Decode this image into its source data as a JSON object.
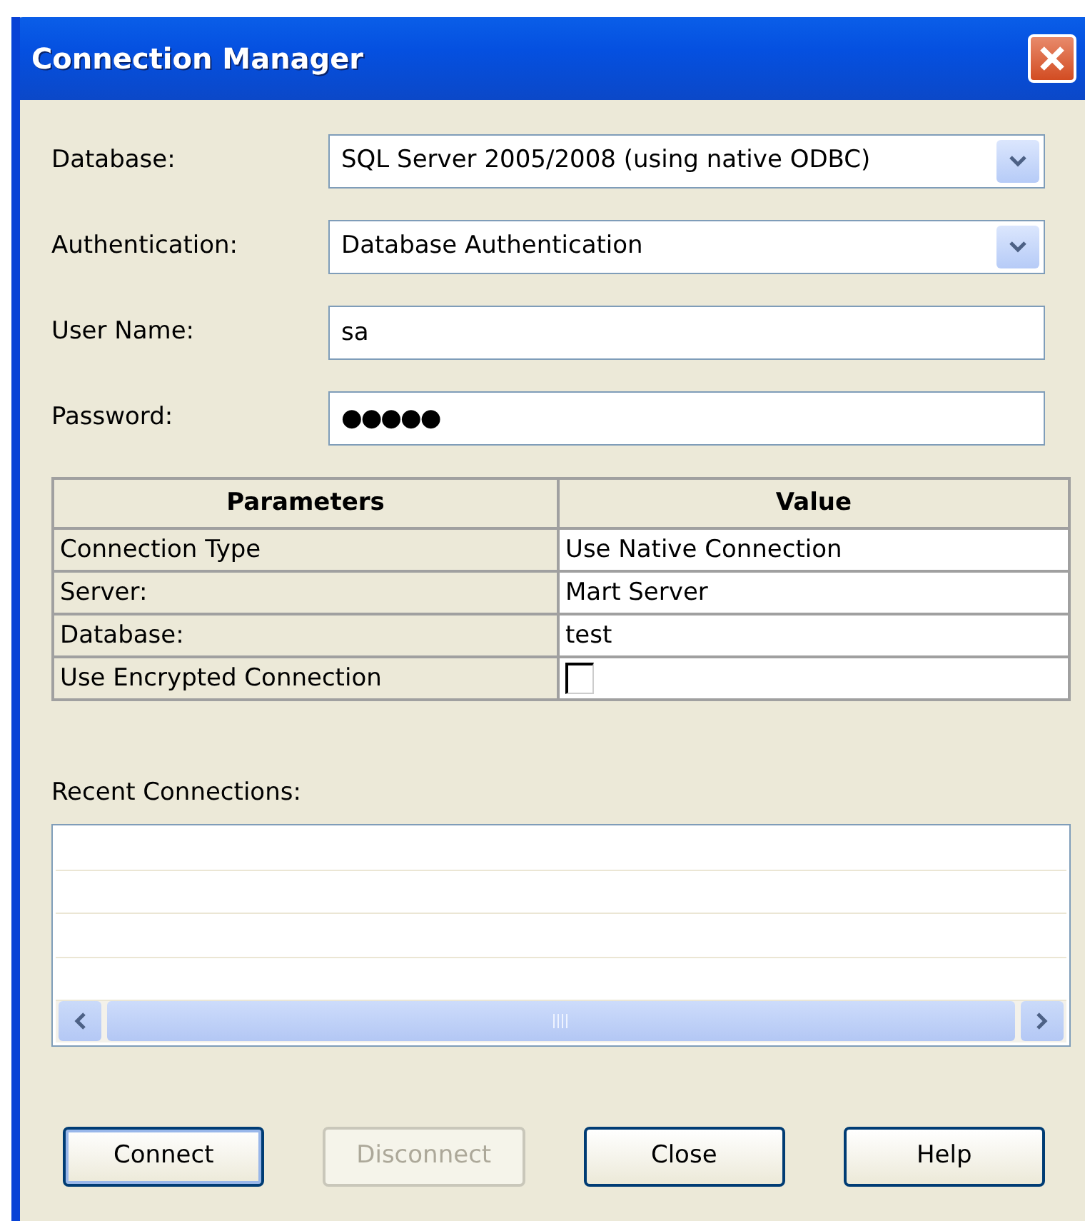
{
  "window": {
    "title": "Connection Manager"
  },
  "fields": [
    {
      "label": "Database:",
      "kind": "dropdown",
      "value": "SQL Server 2005/2008 (using native ODBC)"
    },
    {
      "label": "Authentication:",
      "kind": "dropdown",
      "value": "Database Authentication"
    },
    {
      "label": "User Name:",
      "kind": "text",
      "value": "sa"
    },
    {
      "label": "Password:",
      "kind": "password",
      "value": "●●●●●"
    }
  ],
  "parameters": {
    "columns": [
      "Parameters",
      "Value"
    ],
    "rows": [
      {
        "name": "Connection Type",
        "kind": "text",
        "value": "Use Native Connection"
      },
      {
        "name": "Server:",
        "kind": "text",
        "value": "Mart Server"
      },
      {
        "name": "Database:",
        "kind": "text",
        "value": "test"
      },
      {
        "name": "Use Encrypted Connection",
        "kind": "checkbox",
        "checked": false
      }
    ]
  },
  "recent": {
    "label": "Recent Connections:"
  },
  "buttons": [
    {
      "label": "Connect",
      "disabled": false,
      "default": true
    },
    {
      "label": "Disconnect",
      "disabled": true,
      "default": false
    },
    {
      "label": "Close",
      "disabled": false,
      "default": false
    },
    {
      "label": "Help",
      "disabled": false,
      "default": false
    }
  ]
}
